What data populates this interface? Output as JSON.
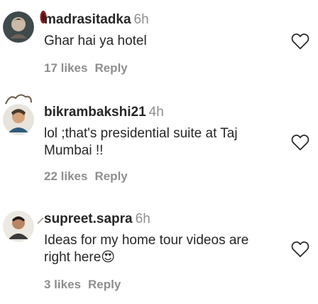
{
  "comments": [
    {
      "username": "madrasitadka",
      "time": "6h",
      "text": "Ghar hai ya hotel",
      "likes": "17 likes",
      "reply": "Reply",
      "avatar_icon": "profile-photo-icon",
      "heart_icon": "heart-outline-icon"
    },
    {
      "username": "bikrambakshi21",
      "time": "4h",
      "text": "lol ;that's presidential suite at Taj Mumbai !!",
      "likes": "22 likes",
      "reply": "Reply",
      "avatar_icon": "profile-photo-icon",
      "heart_icon": "heart-outline-icon"
    },
    {
      "username": "supreet.sapra",
      "time": "6h",
      "text": "Ideas for my home tour videos are right here😍",
      "likes": "3 likes",
      "reply": "Reply",
      "avatar_icon": "profile-photo-icon",
      "heart_icon": "heart-outline-icon"
    }
  ],
  "colors": {
    "text": "#262626",
    "secondary": "#8e8e8e",
    "background": "#ffffff"
  }
}
